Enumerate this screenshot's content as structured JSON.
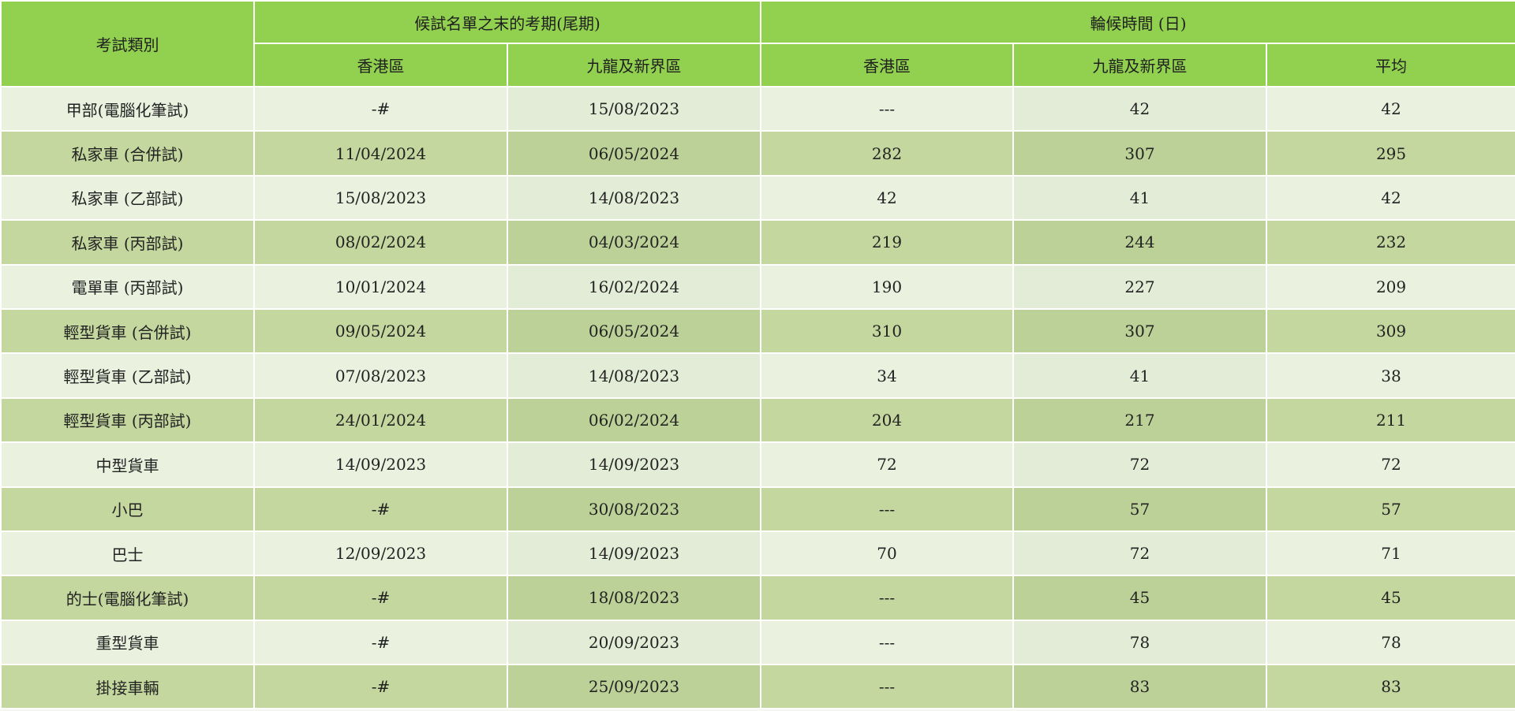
{
  "header": {
    "exam_type": "考試類別",
    "last_exam_date_group": "候試名單之末的考期(尾期)",
    "waiting_time_group": "輪候時間 (日)",
    "sub": {
      "hk": "香港區",
      "kln_nt": "九龍及新界區",
      "hk2": "香港區",
      "kln_nt2": "九龍及新界區",
      "avg": "平均"
    }
  },
  "rows": [
    {
      "type": "甲部(電腦化筆試)",
      "date_hk": "-#",
      "date_kln": "15/08/2023",
      "wait_hk": "---",
      "wait_kln": "42",
      "avg": "42"
    },
    {
      "type": "私家車 (合併試)",
      "date_hk": "11/04/2024",
      "date_kln": "06/05/2024",
      "wait_hk": "282",
      "wait_kln": "307",
      "avg": "295"
    },
    {
      "type": "私家車 (乙部試)",
      "date_hk": "15/08/2023",
      "date_kln": "14/08/2023",
      "wait_hk": "42",
      "wait_kln": "41",
      "avg": "42"
    },
    {
      "type": "私家車 (丙部試)",
      "date_hk": "08/02/2024",
      "date_kln": "04/03/2024",
      "wait_hk": "219",
      "wait_kln": "244",
      "avg": "232"
    },
    {
      "type": "電單車 (丙部試)",
      "date_hk": "10/01/2024",
      "date_kln": "16/02/2024",
      "wait_hk": "190",
      "wait_kln": "227",
      "avg": "209"
    },
    {
      "type": "輕型貨車 (合併試)",
      "date_hk": "09/05/2024",
      "date_kln": "06/05/2024",
      "wait_hk": "310",
      "wait_kln": "307",
      "avg": "309"
    },
    {
      "type": "輕型貨車 (乙部試)",
      "date_hk": "07/08/2023",
      "date_kln": "14/08/2023",
      "wait_hk": "34",
      "wait_kln": "41",
      "avg": "38"
    },
    {
      "type": "輕型貨車 (丙部試)",
      "date_hk": "24/01/2024",
      "date_kln": "06/02/2024",
      "wait_hk": "204",
      "wait_kln": "217",
      "avg": "211"
    },
    {
      "type": "中型貨車",
      "date_hk": "14/09/2023",
      "date_kln": "14/09/2023",
      "wait_hk": "72",
      "wait_kln": "72",
      "avg": "72"
    },
    {
      "type": "小巴",
      "date_hk": "-#",
      "date_kln": "30/08/2023",
      "wait_hk": "---",
      "wait_kln": "57",
      "avg": "57"
    },
    {
      "type": "巴士",
      "date_hk": "12/09/2023",
      "date_kln": "14/09/2023",
      "wait_hk": "70",
      "wait_kln": "72",
      "avg": "71"
    },
    {
      "type": "的士(電腦化筆試)",
      "date_hk": "-#",
      "date_kln": "18/08/2023",
      "wait_hk": "---",
      "wait_kln": "45",
      "avg": "45"
    },
    {
      "type": "重型貨車",
      "date_hk": "-#",
      "date_kln": "20/09/2023",
      "wait_hk": "---",
      "wait_kln": "78",
      "avg": "78"
    },
    {
      "type": "掛接車輛",
      "date_hk": "-#",
      "date_kln": "25/09/2023",
      "wait_hk": "---",
      "wait_kln": "83",
      "avg": "83"
    }
  ]
}
